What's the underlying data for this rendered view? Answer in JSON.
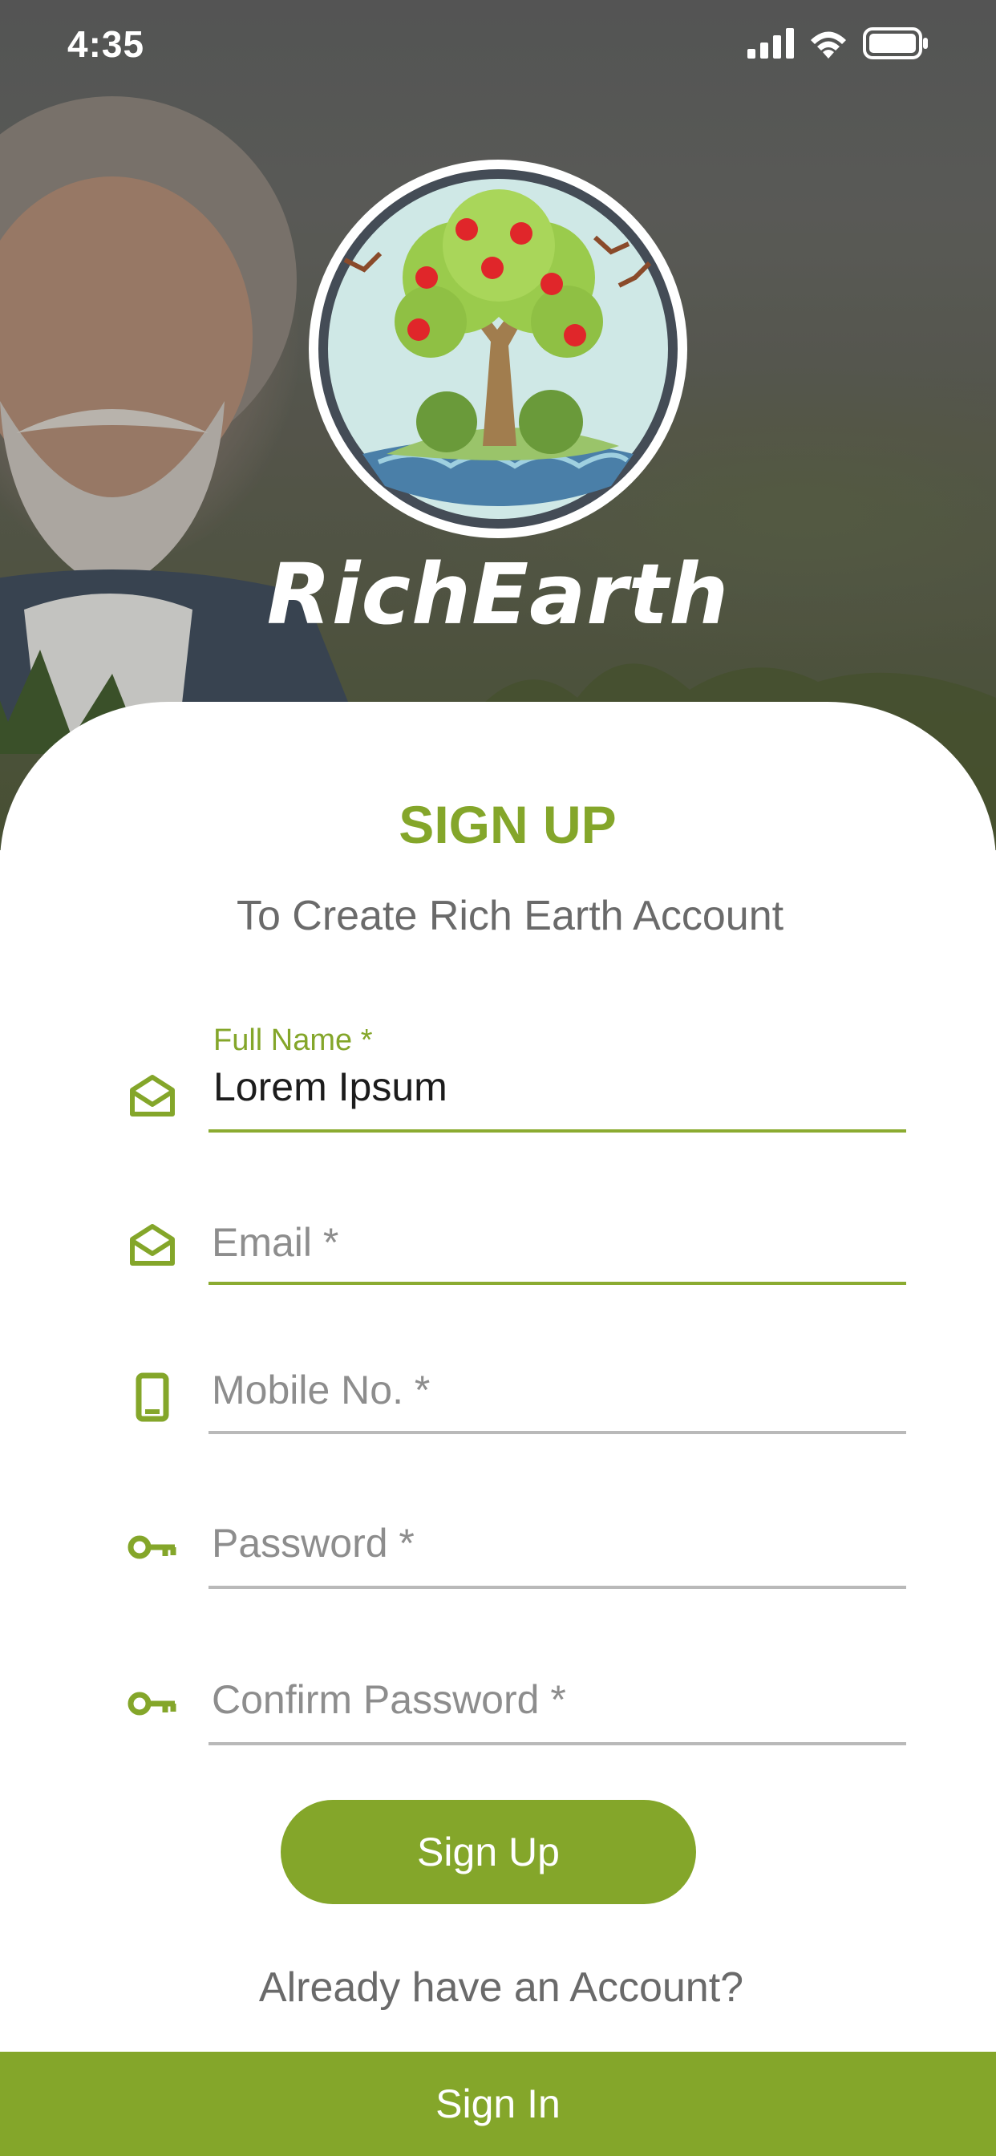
{
  "status_bar": {
    "time": "4:35",
    "icons": [
      "signal-icon",
      "wifi-icon",
      "battery-icon"
    ]
  },
  "brand": {
    "name": "RichEarth"
  },
  "form": {
    "title": "SIGN UP",
    "subtitle": "To Create Rich Earth Account",
    "fields": [
      {
        "label": "Full Name *",
        "value": "Lorem Ipsum",
        "icon": "envelope-icon",
        "state": "filled"
      },
      {
        "placeholder": "Email *",
        "icon": "envelope-icon",
        "state": "focused"
      },
      {
        "placeholder": "Mobile No. *",
        "icon": "mobile-icon",
        "state": "empty"
      },
      {
        "placeholder": "Password *",
        "icon": "key-icon",
        "state": "empty"
      },
      {
        "placeholder": "Confirm Password *",
        "icon": "key-icon",
        "state": "empty"
      }
    ],
    "submit_label": "Sign Up",
    "already_text": "Already have an Account?",
    "signin_label": "Sign In"
  },
  "colors": {
    "accent": "#84a62a",
    "text_muted": "#6a6a6a",
    "placeholder": "#8d8d8d",
    "underline_idle": "#b9b9b9"
  }
}
